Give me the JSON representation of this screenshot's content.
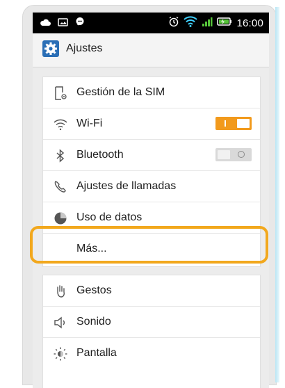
{
  "status_bar": {
    "time": "16:00",
    "left_icons": [
      "cloud-icon",
      "gallery-icon",
      "chat-icon"
    ],
    "right_icons": [
      "alarm-icon",
      "wifi-icon",
      "signal-icon",
      "battery-icon"
    ]
  },
  "app_bar": {
    "icon": "settings-gear-icon",
    "title": "Ajustes"
  },
  "settings": {
    "group1": [
      {
        "id": "sim",
        "icon": "sim-management-icon",
        "label": "Gestión de la SIM"
      },
      {
        "id": "wifi",
        "icon": "wifi-icon",
        "label": "Wi-Fi",
        "toggle": "on"
      },
      {
        "id": "bluetooth",
        "icon": "bluetooth-icon",
        "label": "Bluetooth",
        "toggle": "off"
      },
      {
        "id": "calls",
        "icon": "phone-icon",
        "label": "Ajustes de llamadas"
      },
      {
        "id": "data",
        "icon": "data-usage-icon",
        "label": "Uso de datos"
      },
      {
        "id": "more",
        "icon": "",
        "label": "Más..."
      }
    ],
    "group2": [
      {
        "id": "gestures",
        "icon": "hand-icon",
        "label": "Gestos"
      },
      {
        "id": "sound",
        "icon": "speaker-icon",
        "label": "Sonido"
      },
      {
        "id": "display",
        "icon": "brightness-icon",
        "label": "Pantalla"
      }
    ]
  },
  "colors": {
    "accent_toggle": "#f29a1c",
    "highlight": "#f2a81d",
    "app_icon": "#2b6fb6",
    "status_bar": "#000000",
    "wifi_status": "#3fd0ff",
    "signal_status": "#56c43a"
  }
}
